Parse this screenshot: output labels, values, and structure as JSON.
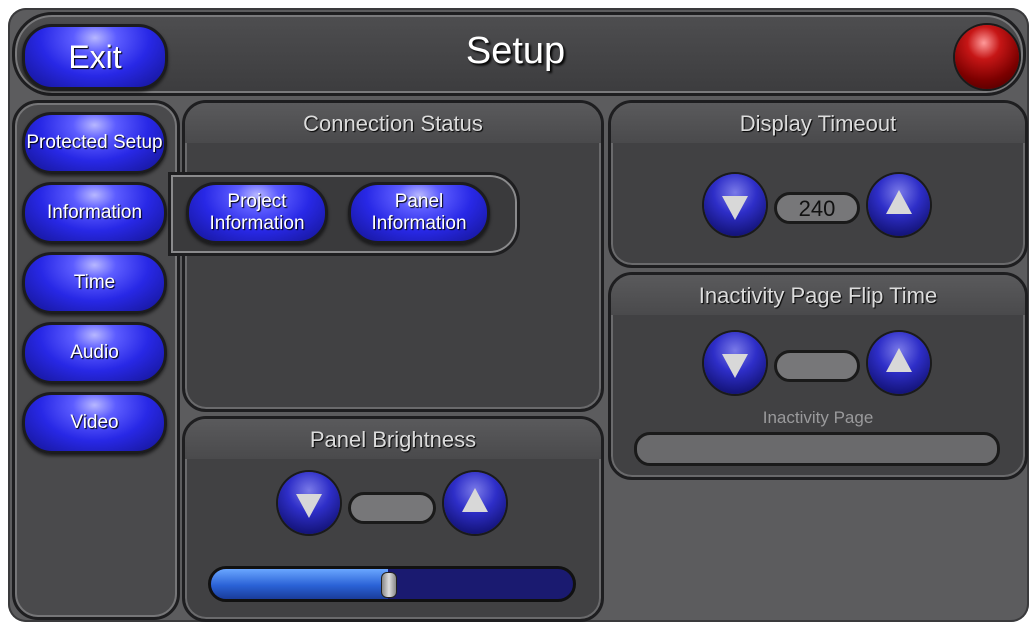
{
  "header": {
    "title": "Setup",
    "exit_label": "Exit",
    "status_light_color": "#c61616"
  },
  "sidebar": {
    "items": [
      {
        "label": "Protected Setup"
      },
      {
        "label": "Information"
      },
      {
        "label": "Time"
      },
      {
        "label": "Audio"
      },
      {
        "label": "Video"
      }
    ]
  },
  "info_submenu": {
    "project_label": "Project Information",
    "panel_label": "Panel Information"
  },
  "connection_status": {
    "title": "Connection Status"
  },
  "display_timeout": {
    "title": "Display Timeout",
    "value": "240"
  },
  "inactivity": {
    "title": "Inactivity Page Flip Time",
    "value": "",
    "page_label": "Inactivity Page",
    "page_value": ""
  },
  "brightness": {
    "title": "Panel Brightness",
    "value": "",
    "level_fraction": 0.49
  },
  "icons": {
    "down": "arrow-down-icon",
    "up": "arrow-up-icon"
  },
  "colors": {
    "button_blue": "#2828e6",
    "panel_gray": "#414143"
  }
}
